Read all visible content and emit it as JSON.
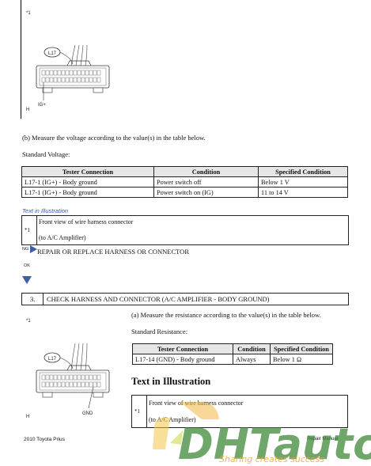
{
  "fig1": {
    "note": "*1",
    "connector": "L17",
    "pin_label": "IG+",
    "corner": "H"
  },
  "instr_b": "(b) Measure the voltage according to the value(s) in the table below.",
  "std_voltage_label": "Standard Voltage:",
  "voltage_table": {
    "headers": [
      "Tester Connection",
      "Condition",
      "Specified Condition"
    ],
    "rows": [
      [
        "L17-1 (IG+) - Body ground",
        "Power switch off",
        "Below 1 V"
      ],
      [
        "L17-1 (IG+) - Body ground",
        "Power switch on (IG)",
        "11 to 14 V"
      ]
    ]
  },
  "text_in_ill_1": {
    "heading": "Text in Illustration",
    "key": "*1",
    "line1": "Front view of wire harness connector",
    "line2": "(to A/C Amplifier)"
  },
  "ng": {
    "label": "NG",
    "text": "REPAIR OR REPLACE HARNESS OR CONNECTOR"
  },
  "ok": {
    "label": "OK"
  },
  "step3": {
    "num": "3.",
    "title": "CHECK HARNESS AND CONNECTOR (A/C AMPLIFIER - BODY GROUND)"
  },
  "fig2": {
    "note": "*1",
    "connector": "L17",
    "pin_label": "GND",
    "corner": "H"
  },
  "instr_a": "(a) Measure the resistance according to the value(s) in the table below.",
  "std_resistance_label": "Standard Resistance:",
  "resistance_table": {
    "headers": [
      "Tester Connection",
      "Condition",
      "Specified Condition"
    ],
    "rows": [
      [
        "L17-14 (GND) - Body ground",
        "Always",
        "Below 1 Ω"
      ]
    ]
  },
  "text_in_ill_2": {
    "heading": "Text in Illustration",
    "key": "*1",
    "line1": "Front view of wire harness connector",
    "line2": "(to A/C Amplifier)"
  },
  "footer": {
    "left": "2010 Toyota Prius",
    "right": "Repair Manual"
  },
  "watermark": {
    "brand": "DHTauto",
    "tagline": "Sharing creates success"
  }
}
